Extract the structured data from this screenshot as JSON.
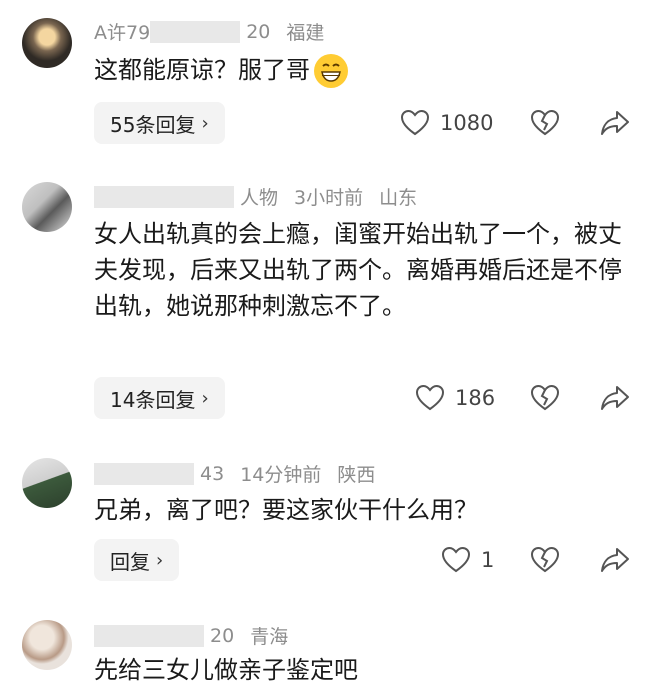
{
  "comments": [
    {
      "user_visible": "A许79",
      "time_visible": "20",
      "location": "福建",
      "text": "这都能原谅？服了哥",
      "emoji": "grinning-face",
      "replies_label": "55条回复",
      "likes": "1080"
    },
    {
      "user_visible": "人物",
      "time": "3小时前",
      "location": "山东",
      "text": "女人出轨真的会上瘾，闺蜜开始出轨了一个，被丈夫发现，后来又出轨了两个。离婚再婚后还是不停出轨，她说那种刺激忘不了。",
      "replies_label": "14条回复",
      "likes": "186"
    },
    {
      "user_visible": "43",
      "time": "14分钟前",
      "location": "陕西",
      "text": "兄弟，离了吧？要这家伙干什么用？",
      "replies_label": "回复",
      "likes": "1"
    },
    {
      "user_visible": "20",
      "location": "青海",
      "text": "先给三女儿做亲子鉴定吧"
    }
  ],
  "icons": {
    "like": "heart-outline-icon",
    "dislike": "broken-heart-icon",
    "share": "share-arrow-icon",
    "chevron": "chevron-right-icon"
  },
  "colors": {
    "meta_text": "#8d8d8d",
    "reply_bg": "#f3f3f3",
    "emoji": "#ffcc33"
  }
}
